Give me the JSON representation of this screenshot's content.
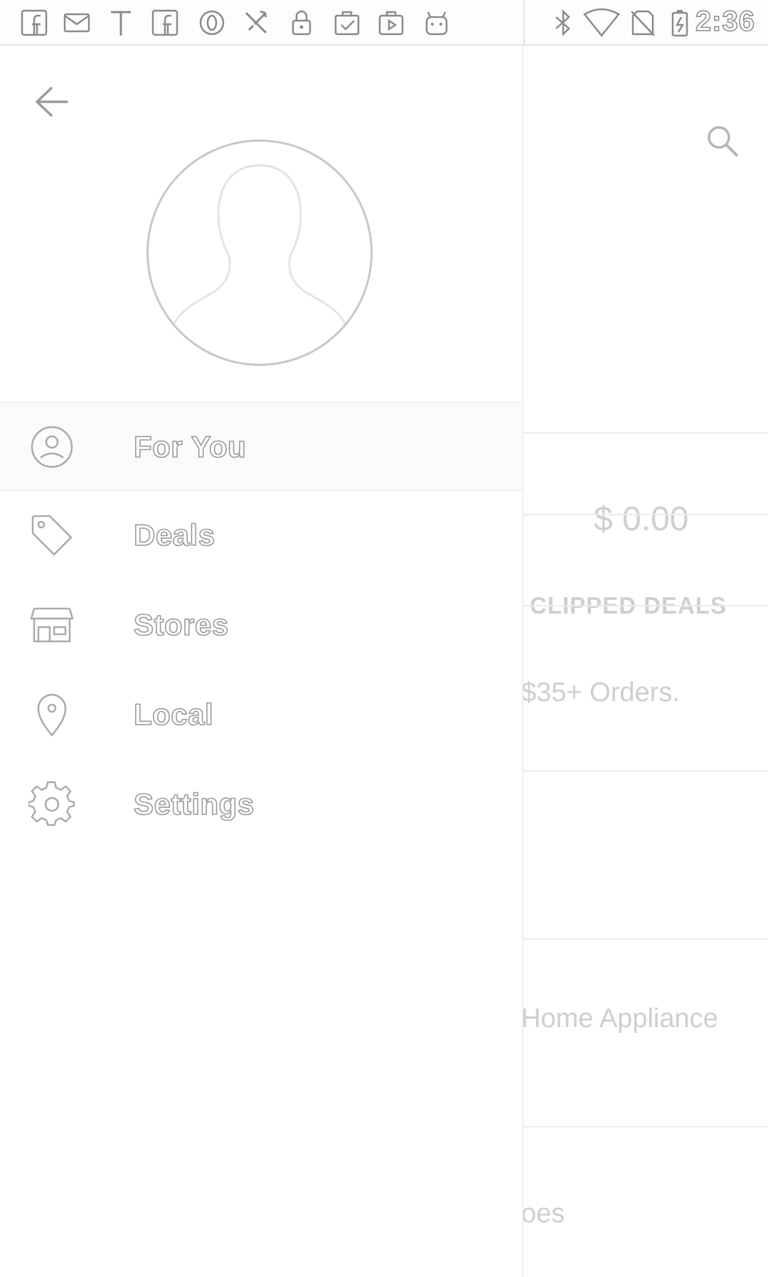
{
  "status_bar": {
    "time": "2:36",
    "left_icons": [
      "facebook-icon",
      "email-icon",
      "text-t-icon",
      "facebook-icon",
      "circle-o-icon",
      "tools-icon",
      "lock-icon",
      "clipboard-check-icon",
      "play-store-icon",
      "android-icon"
    ],
    "right_icons": [
      "bluetooth-icon",
      "wifi-icon",
      "no-sim-icon",
      "battery-charging-icon"
    ]
  },
  "drawer": {
    "back_icon": "arrow-back-icon",
    "avatar_icon": "person-silhouette-icon",
    "items": [
      {
        "label": "For You",
        "icon": "account-circle-icon",
        "selected": true
      },
      {
        "label": "Deals",
        "icon": "tag-icon",
        "selected": false
      },
      {
        "label": "Stores",
        "icon": "storefront-icon",
        "selected": false
      },
      {
        "label": "Local",
        "icon": "location-pin-icon",
        "selected": false
      },
      {
        "label": "Settings",
        "icon": "gear-icon",
        "selected": false
      }
    ]
  },
  "background": {
    "search_icon": "search-icon",
    "amount": "$ 0.00",
    "clipped_deals": "CLIPPED DEALS",
    "orders_text": "$35+ Orders.",
    "appliance_text": "Home Appliance",
    "fragment_text": "oes"
  },
  "colors": {
    "outline_text": "#9a9a9a",
    "background_text": "#cfcfcf",
    "divider": "#ececec"
  }
}
